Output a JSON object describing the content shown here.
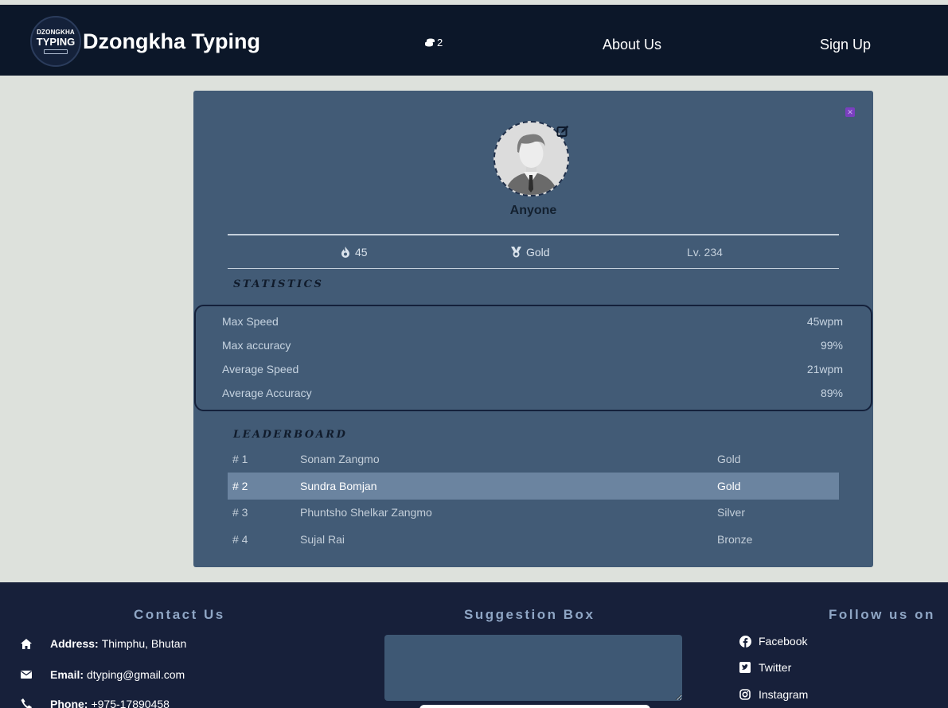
{
  "header": {
    "logo_line1": "DZONGKHA",
    "logo_line2": "TYPING",
    "brand": "Dzongkha Typing",
    "coins": "2",
    "nav": {
      "about": "About Us",
      "signup": "Sign Up"
    }
  },
  "profile": {
    "username": "Anyone",
    "streak": "45",
    "medal": "Gold",
    "level": "Lv. 234",
    "statistics_title": "STATISTICS",
    "statistics": [
      {
        "label": "Max Speed",
        "value": "45wpm"
      },
      {
        "label": "Max accuracy",
        "value": "99%"
      },
      {
        "label": "Average Speed",
        "value": "21wpm"
      },
      {
        "label": "Average Accuracy",
        "value": "89%"
      }
    ],
    "leaderboard_title": "LEADERBOARD",
    "leaderboard": [
      {
        "rank": "# 1",
        "name": "Sonam Zangmo",
        "tier": "Gold"
      },
      {
        "rank": "# 2",
        "name": "Sundra Bomjan",
        "tier": "Gold"
      },
      {
        "rank": "# 3",
        "name": "Phuntsho Shelkar Zangmo",
        "tier": "Silver"
      },
      {
        "rank": "# 4",
        "name": "Sujal Rai",
        "tier": "Bronze"
      }
    ]
  },
  "footer": {
    "contact_title": "Contact Us",
    "contact": {
      "address_label": "Address:",
      "address": "Thimphu, Bhutan",
      "email_label": "Email:",
      "email": "dtyping@gmail.com",
      "phone_label": "Phone:",
      "phone": "+975-17890458"
    },
    "suggestion_title": "Suggestion Box",
    "follow_title": "Follow us on",
    "social": {
      "facebook": "Facebook",
      "twitter": "Twitter",
      "instagram": "Instagram"
    }
  },
  "colors": {
    "header_bg": "#0c1729",
    "page_bg": "#dde1dc",
    "modal_bg": "#425b76",
    "highlight_row": "#6b84a0",
    "footer_bg": "#17203a",
    "footer_title": "#8fa6c5"
  }
}
